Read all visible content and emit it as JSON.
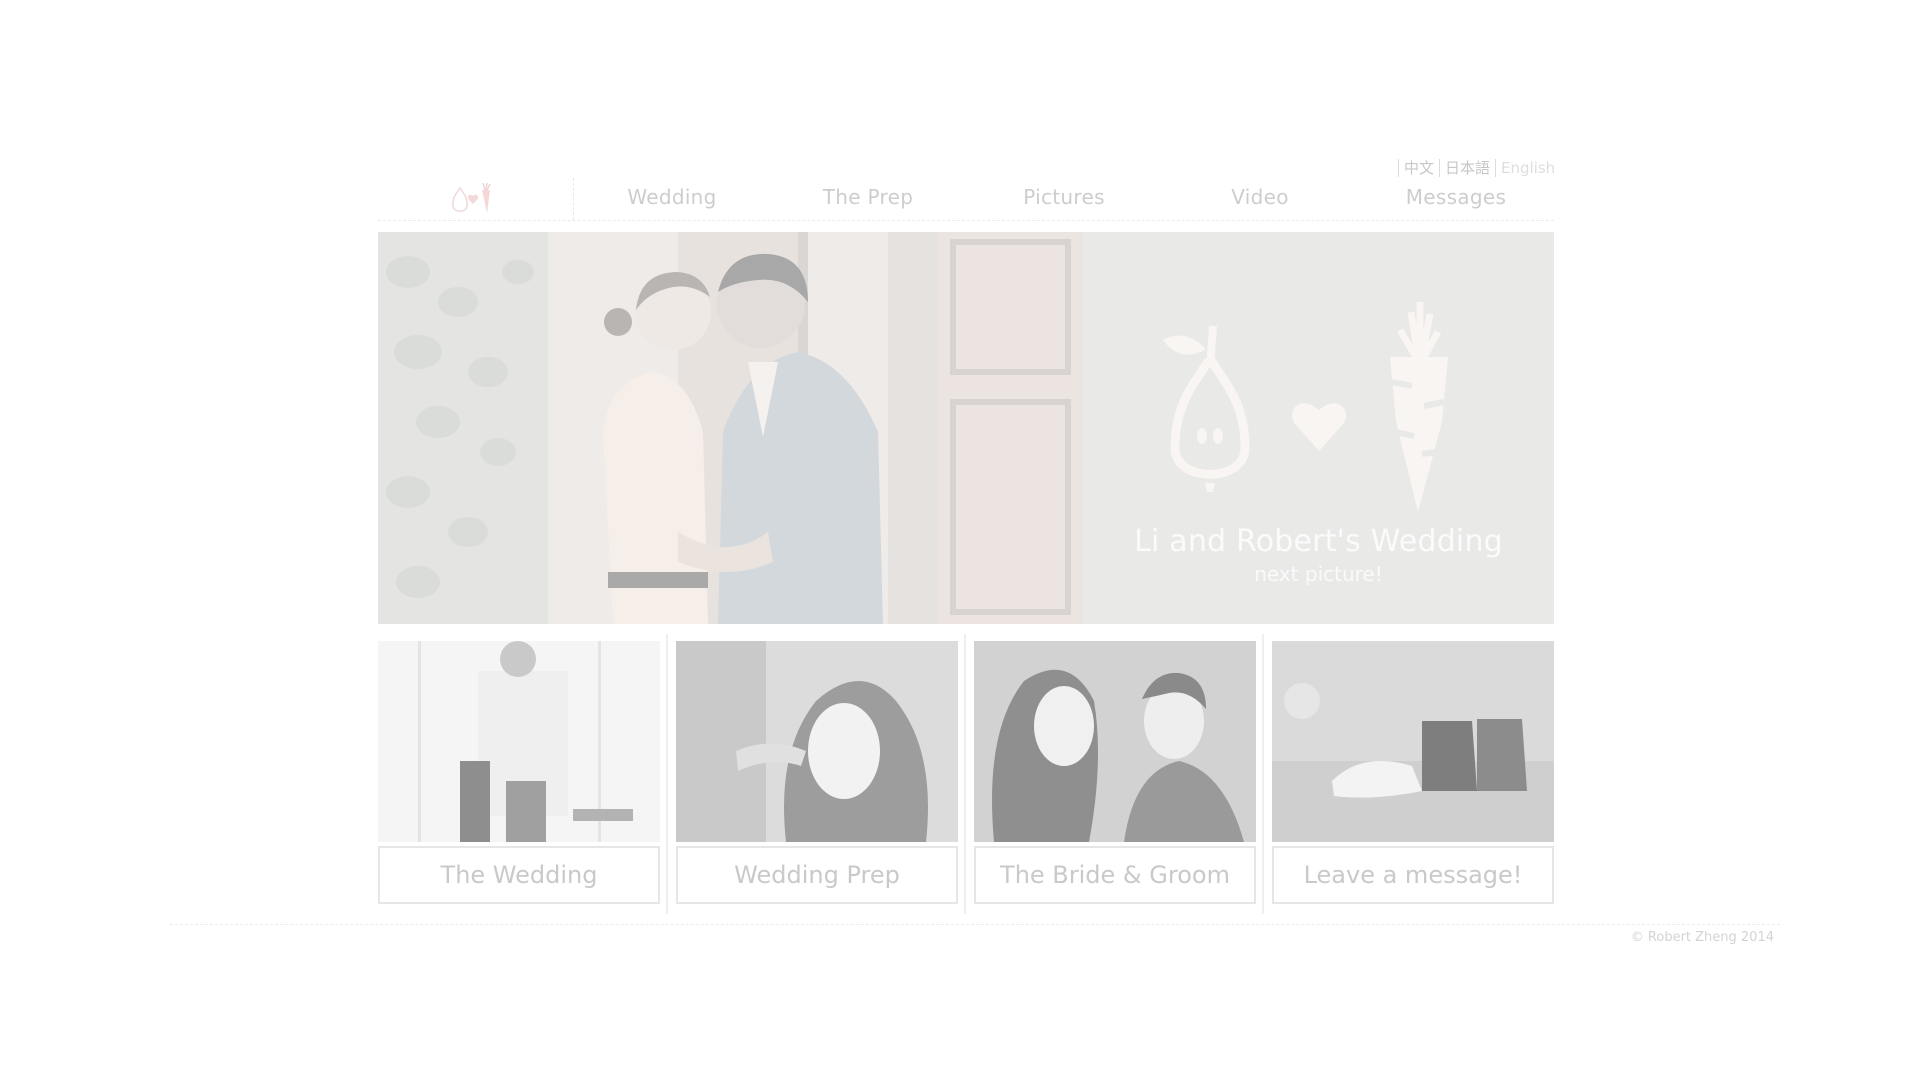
{
  "languages": [
    {
      "label": "中文",
      "active": false
    },
    {
      "label": "日本語",
      "active": false
    },
    {
      "label": "English",
      "active": true
    }
  ],
  "nav": {
    "logo_icon": "pear-heart-carrot-logo",
    "items": [
      "Wedding",
      "The Prep",
      "Pictures",
      "Video",
      "Messages"
    ]
  },
  "hero": {
    "photo": "couple-embracing-photo",
    "icons": [
      "pear-icon",
      "heart-icon",
      "carrot-icon"
    ],
    "title": "Li and Robert's Wedding",
    "next_label": "next picture!"
  },
  "tiles": [
    {
      "photo": "groom-dressing-photo",
      "label": "The Wedding"
    },
    {
      "photo": "bride-makeup-photo",
      "label": "Wedding Prep"
    },
    {
      "photo": "bride-groom-photo",
      "label": "The Bride & Groom"
    },
    {
      "photo": "wedding-shoes-photo",
      "label": "Leave a message!"
    }
  ],
  "footer": {
    "copyright": "© Robert Zheng 2014"
  },
  "colors": {
    "text_light": "#cdcdcd",
    "panel_bg": "#e9e9e8",
    "logo_accent": "#f2dcdc"
  }
}
